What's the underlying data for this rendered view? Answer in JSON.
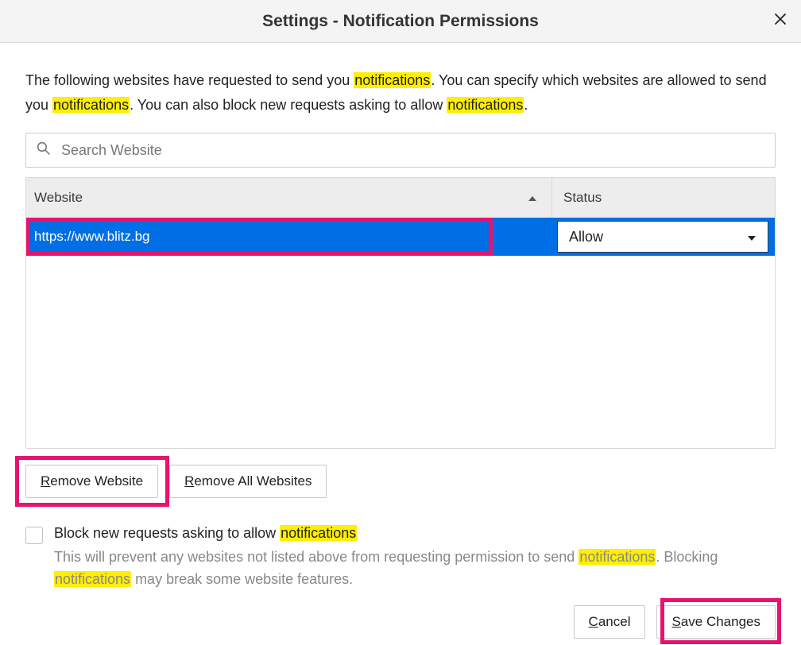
{
  "titlebar": {
    "title": "Settings - Notification Permissions"
  },
  "intro": {
    "p1a": "The following websites have requested to send you ",
    "hl1": "notifications",
    "p1b": ". You can specify which websites are allowed to send you ",
    "hl2": "notifications",
    "p1c": ". You can also block new requests asking to allow ",
    "hl3": "notifications",
    "p1d": "."
  },
  "search": {
    "placeholder": "Search Website"
  },
  "table": {
    "headers": {
      "website": "Website",
      "status": "Status"
    },
    "rows": [
      {
        "url": "https://www.blitz.bg",
        "status": "Allow"
      }
    ]
  },
  "buttons": {
    "remove_website_pre": "R",
    "remove_website_rest": "emove Website",
    "remove_all_pre": "R",
    "remove_all_rest": "emove All Websites",
    "cancel_pre": "C",
    "cancel_rest": "ancel",
    "save_pre": "S",
    "save_rest": "ave Changes"
  },
  "block": {
    "label_a": "Block new requests asking to allow ",
    "label_hl": "notifications",
    "sub_a": "This will prevent any websites not listed above from requesting permission to send ",
    "sub_hl1": "notifications",
    "sub_b": ". Blocking ",
    "sub_hl2": "notifications",
    "sub_c": " may break some website features."
  }
}
